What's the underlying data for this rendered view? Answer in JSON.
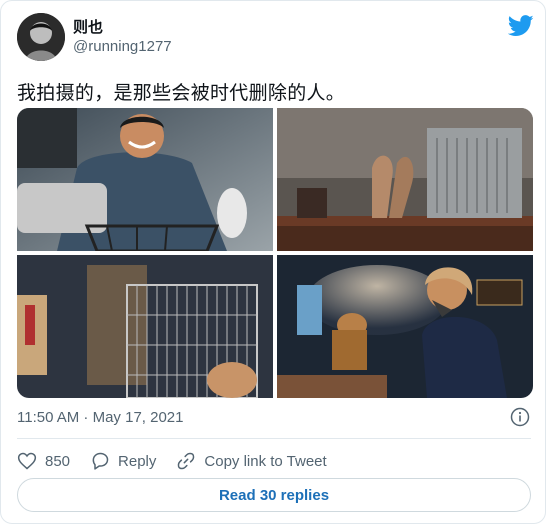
{
  "author": {
    "name": "则也",
    "handle": "@running1277"
  },
  "tweet": {
    "text": "我拍摄的，是那些会被时代删除的人。",
    "timestamp": "11:50 AM · May 17, 2021"
  },
  "actions": {
    "likes": "850",
    "reply_label": "Reply",
    "copy_link_label": "Copy link to Tweet"
  },
  "read_replies_label": "Read 30 replies",
  "icons": {
    "brand": "twitter-bird-icon",
    "info": "info-icon",
    "like": "heart-icon",
    "reply": "reply-bubble-icon",
    "copy": "link-icon"
  },
  "colors": {
    "brand": "#1d9bf0",
    "link": "#1d70b8",
    "muted": "#536471"
  }
}
